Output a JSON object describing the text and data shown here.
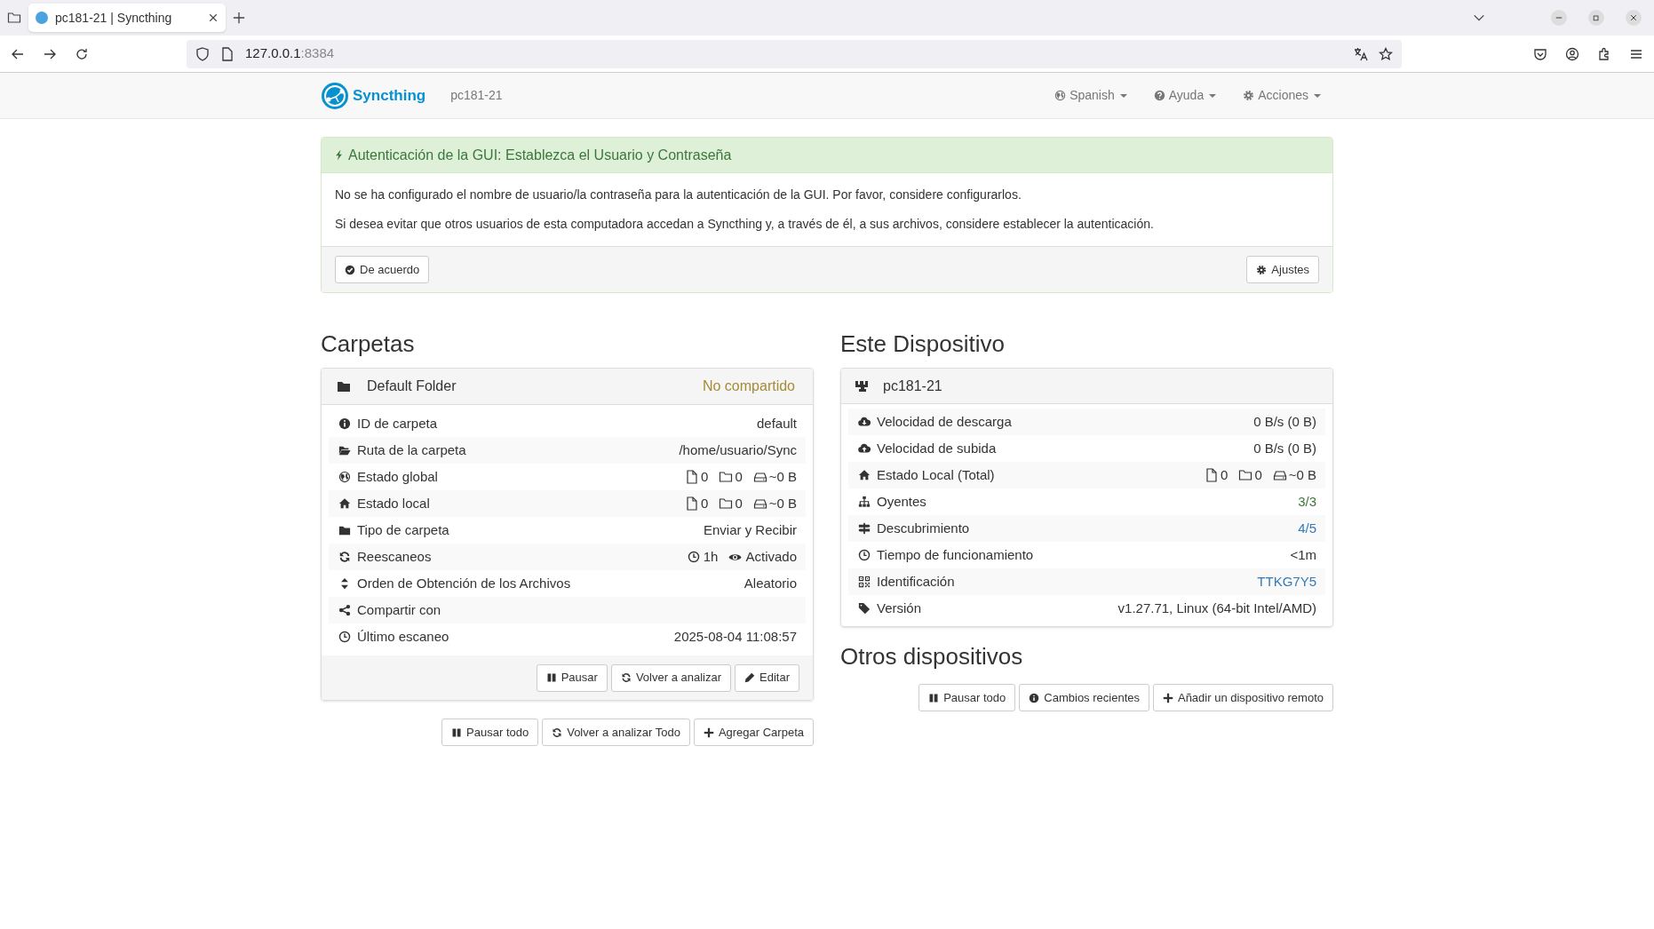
{
  "browser": {
    "tab_title": "pc181-21 | Syncthing",
    "url_host": "127.0.0.1",
    "url_port": ":8384"
  },
  "navbar": {
    "brand": "Syncthing",
    "device": "pc181-21",
    "menus": [
      "Spanish",
      "Ayuda",
      "Acciones"
    ]
  },
  "alert": {
    "title": "Autenticación de la GUI: Establezca el Usuario y Contraseña",
    "paragraphs": [
      "No se ha configurado el nombre de usuario/la contraseña para la autenticación de la GUI. Por favor, considere configurarlos.",
      "Si desea evitar que otros usuarios de esta computadora accedan a Syncthing y, a través de él, a sus archivos, considere establecer la autenticación."
    ],
    "buttons": [
      "De acuerdo",
      "Ajustes"
    ]
  },
  "folders": {
    "heading": "Carpetas",
    "panels": [
      {
        "name": "Default Folder",
        "status": "No compartido",
        "rows": [
          {
            "label": "ID de carpeta",
            "kind": "text",
            "value": "default"
          },
          {
            "label": "Ruta de la carpeta",
            "kind": "text",
            "value": "/home/usuario/Sync"
          },
          {
            "label": "Estado global",
            "kind": "counts",
            "files": "0",
            "folders": "0",
            "size": "~0 B"
          },
          {
            "label": "Estado local",
            "kind": "counts",
            "files": "0",
            "folders": "0",
            "size": "~0 B"
          },
          {
            "label": "Tipo de carpeta",
            "kind": "text",
            "value": "Enviar y Recibir"
          },
          {
            "label": "Reescaneos",
            "kind": "rescan",
            "interval": "1h",
            "watcher": "Activado"
          },
          {
            "label": "Orden de Obtención de los Archivos",
            "kind": "text",
            "value": "Aleatorio"
          },
          {
            "label": "Compartir con",
            "kind": "label_only"
          },
          {
            "label": "Último escaneo",
            "kind": "text",
            "value": "2025-08-04 11:08:57"
          }
        ],
        "buttons": [
          "Pausar",
          "Volver a analizar",
          "Editar"
        ]
      }
    ],
    "buttons": [
      "Pausar todo",
      "Volver a analizar Todo",
      "Agregar Carpeta"
    ]
  },
  "this_device": {
    "heading": "Este Dispositivo",
    "name": "pc181-21",
    "rows": [
      {
        "label": "Velocidad de descarga",
        "kind": "text",
        "value": "0 B/s (0 B)"
      },
      {
        "label": "Velocidad de subida",
        "kind": "text",
        "value": "0 B/s (0 B)"
      },
      {
        "label": "Estado Local (Total)",
        "kind": "counts",
        "files": "0",
        "folders": "0",
        "size": "~0 B"
      },
      {
        "label": "Oyentes",
        "kind": "ok",
        "value": "3/3"
      },
      {
        "label": "Descubrimiento",
        "kind": "link",
        "value": "4/5"
      },
      {
        "label": "Tiempo de funcionamiento",
        "kind": "text",
        "value": "<1m"
      },
      {
        "label": "Identificación",
        "kind": "link",
        "value": "TTKG7Y5"
      },
      {
        "label": "Versión",
        "kind": "text",
        "value": "v1.27.71, Linux (64-bit Intel/AMD)"
      }
    ]
  },
  "other_devices": {
    "heading": "Otros dispositivos",
    "buttons": [
      "Pausar todo",
      "Cambios recientes",
      "Añadir un dispositivo remoto"
    ]
  }
}
